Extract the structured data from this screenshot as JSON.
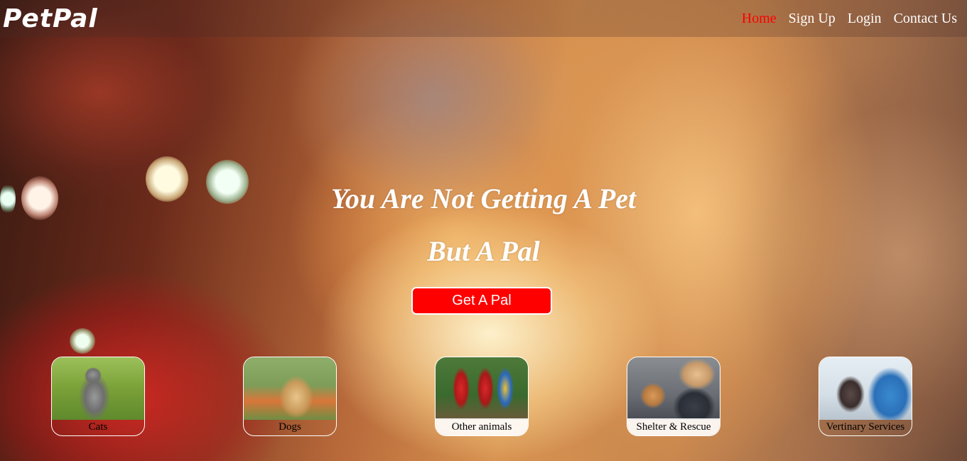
{
  "header": {
    "logo": "PetPal",
    "nav": [
      {
        "label": "Home",
        "active": true
      },
      {
        "label": "Sign Up",
        "active": false
      },
      {
        "label": "Login",
        "active": false
      },
      {
        "label": "Contact Us",
        "active": false
      }
    ]
  },
  "hero": {
    "title_line1": "You Are Not Getting A Pet",
    "title_line2": "But A Pal",
    "cta_label": "Get A Pal"
  },
  "categories": [
    {
      "label": "Cats"
    },
    {
      "label": "Dogs"
    },
    {
      "label": "Other animals"
    },
    {
      "label": "Shelter & Rescue"
    },
    {
      "label": "Vertinary Services"
    }
  ],
  "colors": {
    "accent": "#ff0000",
    "nav_text": "#ffffff"
  }
}
